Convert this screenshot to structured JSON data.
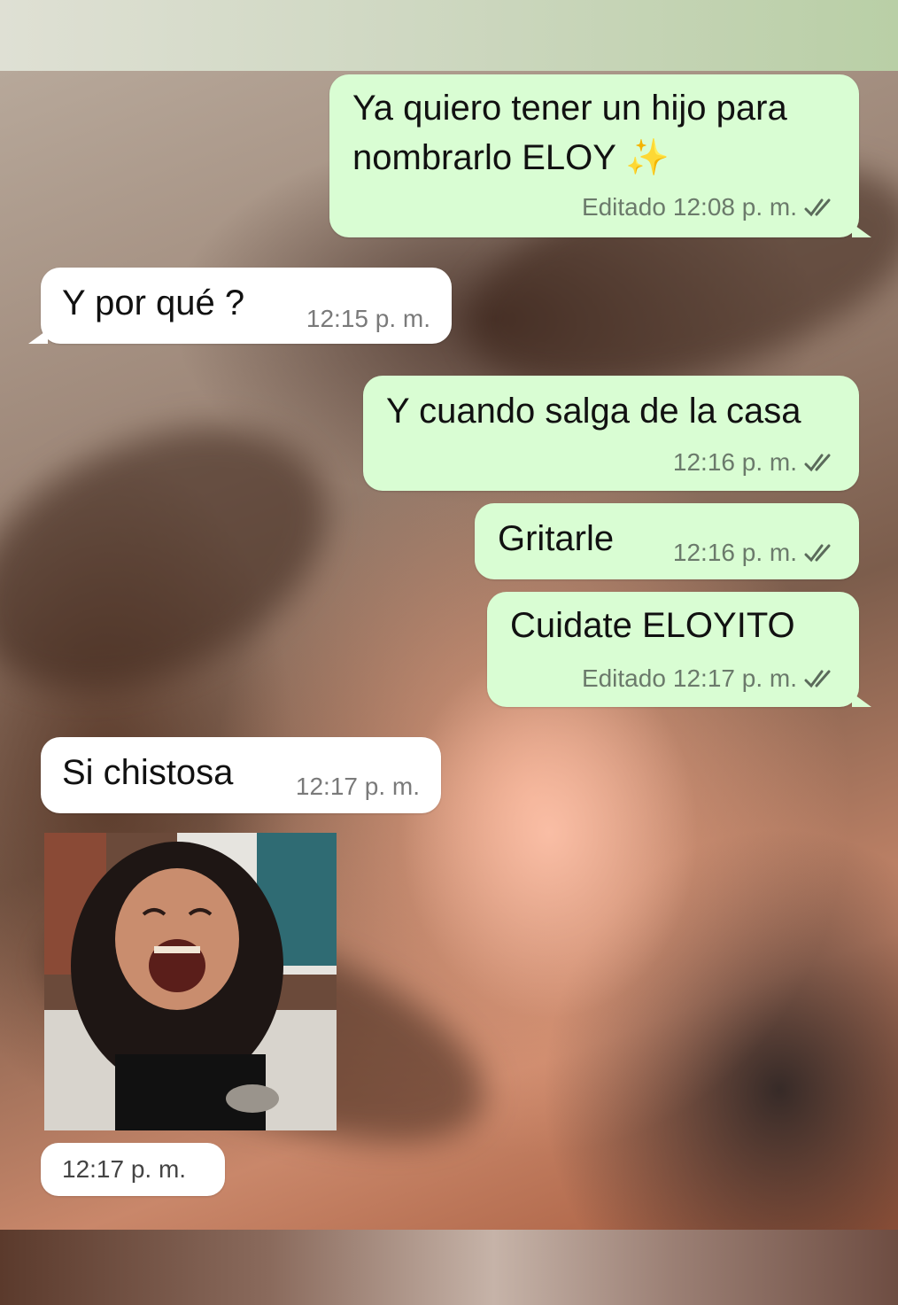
{
  "messages": [
    {
      "id": "m1",
      "direction": "outgoing",
      "line1": "Ya quiero tener un hijo para",
      "line2": "nombrarlo ELOY ✨",
      "edited": "Editado",
      "time": "12:08 p. m.",
      "status": "read"
    },
    {
      "id": "m2",
      "direction": "incoming",
      "text": "Y por qué ?",
      "time": "12:15 p. m."
    },
    {
      "id": "m3",
      "direction": "outgoing",
      "text": "Y cuando salga de la casa",
      "time": "12:16 p. m.",
      "status": "read"
    },
    {
      "id": "m4",
      "direction": "outgoing",
      "text": "Gritarle",
      "time": "12:16 p. m.",
      "status": "read"
    },
    {
      "id": "m5",
      "direction": "outgoing",
      "text": "Cuidate ELOYITO",
      "edited": "Editado",
      "time": "12:17 p. m.",
      "status": "read"
    },
    {
      "id": "m6",
      "direction": "incoming",
      "text": "Si chistosa",
      "time": "12:17 p. m."
    },
    {
      "id": "m7",
      "direction": "incoming",
      "type": "image",
      "image": "laughing-girl-photo",
      "time": "12:17 p. m."
    }
  ],
  "colors": {
    "outgoing_bubble": "#d9fdd3",
    "incoming_bubble": "#ffffff",
    "read_ticks": "#5b6b5b"
  },
  "icons": {
    "status": "double-check-icon",
    "sparkles": "sparkles-emoji"
  }
}
